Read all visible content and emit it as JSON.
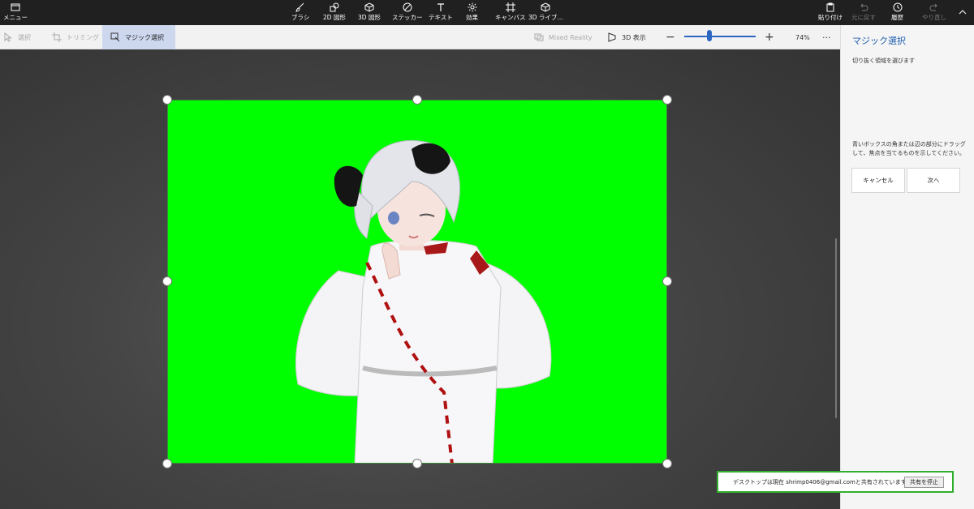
{
  "topbar": {
    "menu": "メニュー",
    "tools": [
      {
        "label": "ブラシ",
        "icon": "brush-icon"
      },
      {
        "label": "2D 図形",
        "icon": "2d-shapes-icon"
      },
      {
        "label": "3D 図形",
        "icon": "3d-shapes-icon"
      },
      {
        "label": "ステッカー",
        "icon": "sticker-icon"
      },
      {
        "label": "テキスト",
        "icon": "text-icon"
      },
      {
        "label": "効果",
        "icon": "effects-icon"
      },
      {
        "label": "キャンバス",
        "icon": "canvas-icon"
      },
      {
        "label": "3D ライブ...",
        "icon": "3d-library-icon"
      }
    ],
    "paste": "貼り付け",
    "undo": "元に戻す",
    "history": "履歴",
    "redo": "やり直し"
  },
  "subbar": {
    "select": "選択",
    "crop": "トリミング",
    "magic_select": "マジック選択",
    "mixed_reality": "Mixed Reality",
    "view_3d": "3D 表示",
    "zoom_level": "74%",
    "zoom_fraction": 0.35
  },
  "panel": {
    "title": "マジック選択",
    "hint": "切り抜く領域を選びます",
    "description": "青いボックスの角または辺の部分にドラッグして、焦点を当てるものを示してください。",
    "cancel": "キャンセル",
    "next": "次へ"
  },
  "toast": {
    "message": "デスクトップは現在 shrimp0406@gmail.comと共有されています。",
    "stop_button": "共有を停止"
  },
  "colors": {
    "accent": "#1f5fad",
    "slider": "#2a66c2",
    "chroma": "#00ff00",
    "toast_border": "#31b02f"
  }
}
